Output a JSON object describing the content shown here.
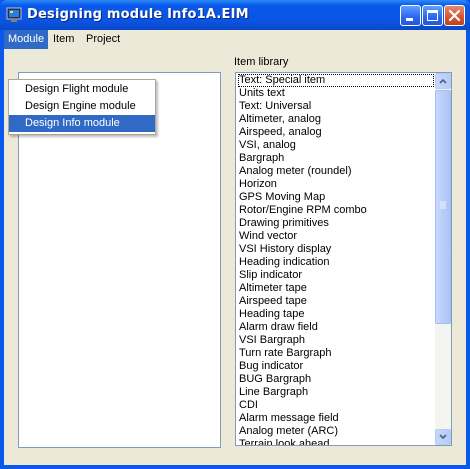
{
  "window": {
    "title": "Designing module Info1A.EIM"
  },
  "menubar": {
    "items": [
      {
        "label": "Module"
      },
      {
        "label": "Item"
      },
      {
        "label": "Project"
      }
    ]
  },
  "module_menu": {
    "items": [
      {
        "label": "Design Flight module"
      },
      {
        "label": "Design Engine module"
      },
      {
        "label": "Design Info module"
      }
    ],
    "highlighted_index": 2
  },
  "item_library": {
    "label": "Item library",
    "selected_index": 0,
    "items": [
      "Text: Special item",
      "Units text",
      "Text: Universal",
      "Altimeter, analog",
      "Airspeed, analog",
      "VSI, analog",
      "Bargraph",
      "Analog meter (roundel)",
      "Horizon",
      "GPS Moving Map",
      "Rotor/Engine RPM combo",
      "Drawing primitives",
      "Wind vector",
      "VSI History display",
      "Heading indication",
      "Slip indicator",
      "Altimeter tape",
      "Airspeed tape",
      "Heading tape",
      "Alarm draw field",
      "VSI Bargraph",
      "Turn rate Bargraph",
      "Bug indicator",
      "BUG Bargraph",
      "Line Bargraph",
      "CDI",
      "Alarm message field",
      "Analog meter (ARC)",
      "Terrain look ahead"
    ]
  },
  "colors": {
    "titlebar": "#0a58ec",
    "selection": "#316ac5",
    "face": "#ece9d8"
  }
}
